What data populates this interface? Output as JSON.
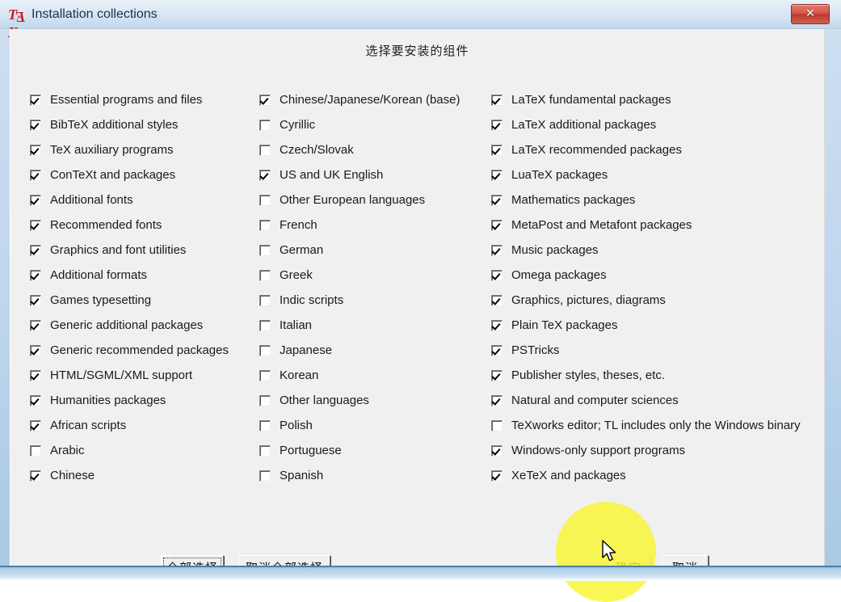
{
  "window": {
    "title": "Installation collections",
    "icon": "tex-logo-icon",
    "close_label": "✕",
    "accent_close_color": "#c0392b",
    "titlebar_color": "#dde8f4",
    "client_bg_color": "#f0f0f0"
  },
  "dialog": {
    "heading": "选择要安装的组件"
  },
  "columns": [
    {
      "id": "collections-column-1",
      "items": [
        {
          "label": "Essential programs and files",
          "checked": true
        },
        {
          "label": "BibTeX additional styles",
          "checked": true
        },
        {
          "label": "TeX auxiliary programs",
          "checked": true
        },
        {
          "label": "ConTeXt and packages",
          "checked": true
        },
        {
          "label": "Additional fonts",
          "checked": true
        },
        {
          "label": "Recommended fonts",
          "checked": true
        },
        {
          "label": "Graphics and font utilities",
          "checked": true
        },
        {
          "label": "Additional formats",
          "checked": true
        },
        {
          "label": "Games typesetting",
          "checked": true
        },
        {
          "label": "Generic additional packages",
          "checked": true
        },
        {
          "label": "Generic recommended packages",
          "checked": true
        },
        {
          "label": "HTML/SGML/XML support",
          "checked": true
        },
        {
          "label": "Humanities packages",
          "checked": true
        },
        {
          "label": "African scripts",
          "checked": true
        },
        {
          "label": "Arabic",
          "checked": false
        },
        {
          "label": "Chinese",
          "checked": true
        }
      ]
    },
    {
      "id": "collections-column-2",
      "items": [
        {
          "label": "Chinese/Japanese/Korean (base)",
          "checked": true
        },
        {
          "label": "Cyrillic",
          "checked": false
        },
        {
          "label": "Czech/Slovak",
          "checked": false
        },
        {
          "label": "US and UK English",
          "checked": true
        },
        {
          "label": "Other European languages",
          "checked": false
        },
        {
          "label": "French",
          "checked": false
        },
        {
          "label": "German",
          "checked": false
        },
        {
          "label": "Greek",
          "checked": false
        },
        {
          "label": "Indic scripts",
          "checked": false
        },
        {
          "label": "Italian",
          "checked": false
        },
        {
          "label": "Japanese",
          "checked": false
        },
        {
          "label": "Korean",
          "checked": false
        },
        {
          "label": "Other languages",
          "checked": false
        },
        {
          "label": "Polish",
          "checked": false
        },
        {
          "label": "Portuguese",
          "checked": false
        },
        {
          "label": "Spanish",
          "checked": false
        }
      ]
    },
    {
      "id": "collections-column-3",
      "items": [
        {
          "label": "LaTeX fundamental packages",
          "checked": true
        },
        {
          "label": "LaTeX additional packages",
          "checked": true
        },
        {
          "label": "LaTeX recommended packages",
          "checked": true
        },
        {
          "label": "LuaTeX packages",
          "checked": true
        },
        {
          "label": "Mathematics packages",
          "checked": true
        },
        {
          "label": "MetaPost and Metafont packages",
          "checked": true
        },
        {
          "label": "Music packages",
          "checked": true
        },
        {
          "label": "Omega packages",
          "checked": true
        },
        {
          "label": "Graphics, pictures, diagrams",
          "checked": true
        },
        {
          "label": "Plain TeX packages",
          "checked": true
        },
        {
          "label": "PSTricks",
          "checked": true
        },
        {
          "label": "Publisher styles, theses, etc.",
          "checked": true
        },
        {
          "label": "Natural and computer sciences",
          "checked": true
        },
        {
          "label": "TeXworks editor; TL includes only the Windows binary",
          "checked": false
        },
        {
          "label": "Windows-only support programs",
          "checked": true
        },
        {
          "label": "XeTeX and packages",
          "checked": true
        }
      ]
    }
  ],
  "buttons": {
    "select_all": "全部选择",
    "deselect_all": "取消全部选择",
    "ok": "确定",
    "cancel": "取消"
  },
  "interaction": {
    "highlight_color": "#f7f531",
    "cursor": "arrow-pointer"
  }
}
